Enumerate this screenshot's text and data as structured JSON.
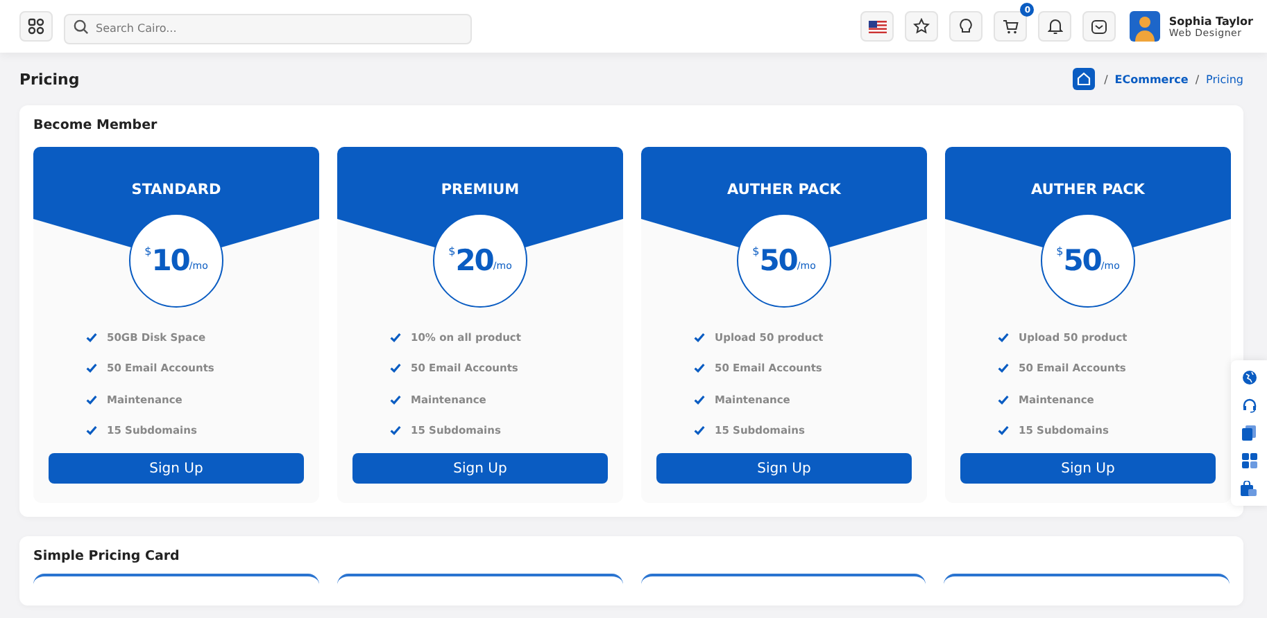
{
  "header": {
    "search": {
      "placeholder": "Search Cairo..."
    },
    "cart_badge": "0",
    "user": {
      "name": "Sophia Taylor",
      "role": "Web Designer"
    }
  },
  "page": {
    "title": "Pricing",
    "breadcrumb": [
      {
        "separator": "/",
        "label": "ECommerce",
        "selected": false
      },
      {
        "separator": "/",
        "label": "Pricing",
        "selected": true
      }
    ]
  },
  "member_section": {
    "title": "Become Member",
    "plans": [
      {
        "name": "STANDARD",
        "currency": "$",
        "amount": "10",
        "period": "/mo",
        "features": [
          "50GB Disk Space",
          "50 Email Accounts",
          "Maintenance",
          "15 Subdomains"
        ],
        "button": "Sign Up"
      },
      {
        "name": "PREMIUM",
        "currency": "$",
        "amount": "20",
        "period": "/mo",
        "features": [
          "10% on all product",
          "50 Email Accounts",
          "Maintenance",
          "15 Subdomains"
        ],
        "button": "Sign Up"
      },
      {
        "name": "AUTHER PACK",
        "currency": "$",
        "amount": "50",
        "period": "/mo",
        "features": [
          "Upload 50 product",
          "50 Email Accounts",
          "Maintenance",
          "15 Subdomains"
        ],
        "button": "Sign Up"
      },
      {
        "name": "AUTHER PACK",
        "currency": "$",
        "amount": "50",
        "period": "/mo",
        "features": [
          "Upload 50 product",
          "50 Email Accounts",
          "Maintenance",
          "15 Subdomains"
        ],
        "button": "Sign Up"
      }
    ]
  },
  "simple_section": {
    "title": "Simple Pricing Card"
  }
}
